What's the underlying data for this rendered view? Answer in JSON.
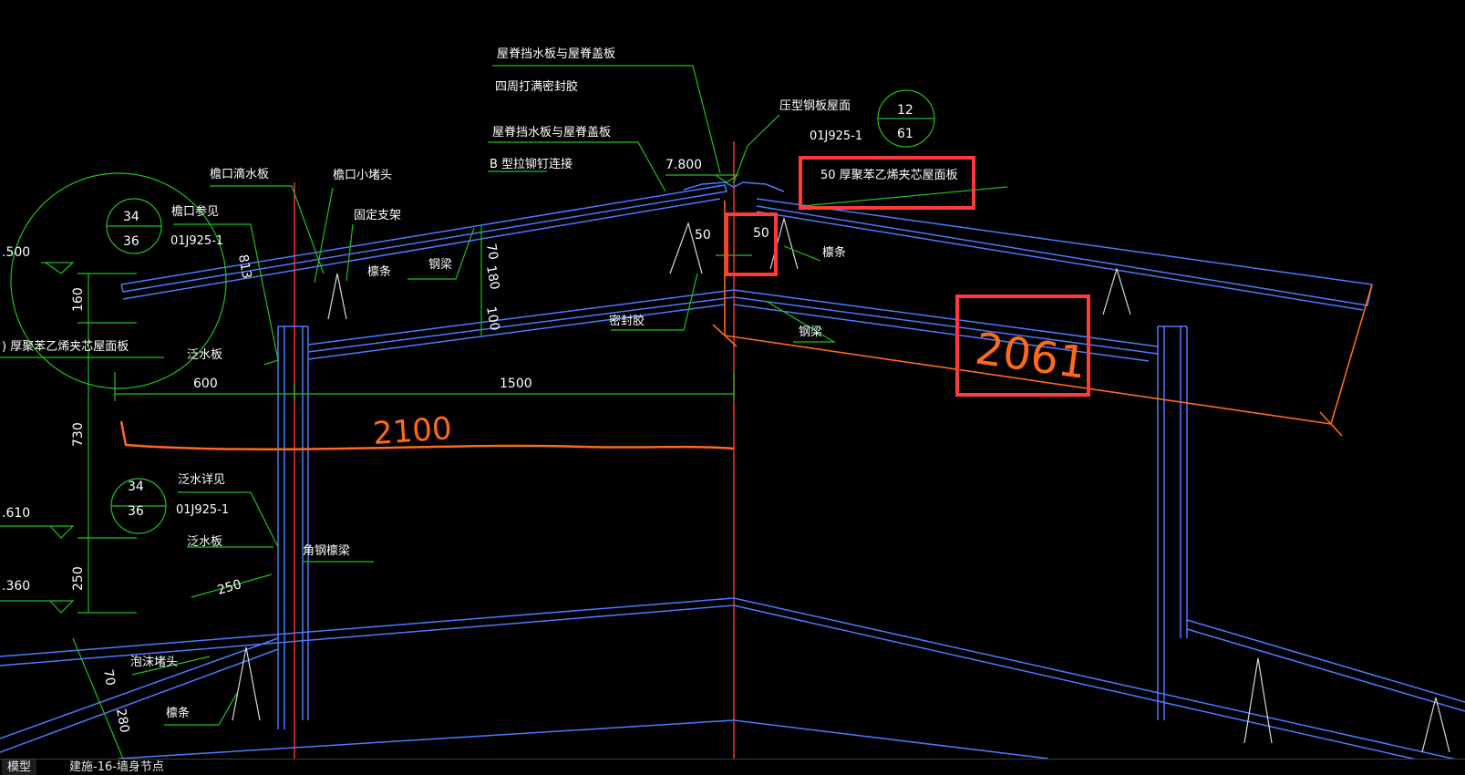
{
  "colors": {
    "background": "#000000",
    "structure": "#4a7bff",
    "leader": "#20c020",
    "axis": "#ff2a2a",
    "orange_dim": "#ff6a1a",
    "text": "#ffffff",
    "highlight_box": "#ff3b3b"
  },
  "annotations": {
    "ridge_cover_1": "屋脊挡水板与屋脊盖板",
    "sealant_around": "四周打满密封胶",
    "pressed_steel_roof": "压型钢板屋面",
    "detail_ref_12_top": "12",
    "detail_ref_12_bottom": "61",
    "atlas_ref_1": "01J925-1",
    "ridge_cover_2": "屋脊挡水板与屋脊盖板",
    "b_rivet": "B 型拉铆钉连接",
    "elevation_ridge": "7.800",
    "panel_50_callout": "50 厚聚苯乙烯夹芯屋面板",
    "eave_drip": "檐口滴水板",
    "eave_plug": "檐口小堵头",
    "fixed_bracket": "固定支架",
    "eave_see": "檐口参见",
    "detail_34_top_a": "34",
    "detail_36_bottom_a": "36",
    "atlas_ref_2": "01J925-1",
    "purlin_left": "檩条",
    "steel_beam_left": "钢梁",
    "purlin_right": "檩条",
    "sealant": "密封胶",
    "steel_beam_right": "钢梁",
    "flashing_1": "泛水板",
    "panel_left_cut": ") 厚聚苯乙烯夹芯屋面板",
    "elev_left_top": ".500",
    "flashing_detail": "泛水详见",
    "detail_34_top_b": "34",
    "detail_36_bottom_b": "36",
    "atlas_ref_3": "01J925-1",
    "flashing_2": "泛水板",
    "angle_steel_beam": "角钢檩梁",
    "elev_left_mid": ".610",
    "elev_left_low": ".360",
    "foam_plug": "泡沫堵头",
    "purlin_bottom": "檩条"
  },
  "dimensions": {
    "d_160": "160",
    "d_730": "730",
    "d_250_v": "250",
    "d_600": "600",
    "d_1500": "1500",
    "d_70": "70",
    "d_180": "180",
    "d_100": "100",
    "d_813": "813",
    "d_50_a": "50",
    "d_50_b": "50",
    "d_250_slant": "250",
    "d_70_b": "70",
    "d_280": "280"
  },
  "handwritten": {
    "h_2100": "2100",
    "h_2061": "2061"
  },
  "tabs": [
    {
      "label": "模型",
      "active": true
    },
    {
      "label": "建施-16-墙身节点",
      "active": false
    }
  ]
}
